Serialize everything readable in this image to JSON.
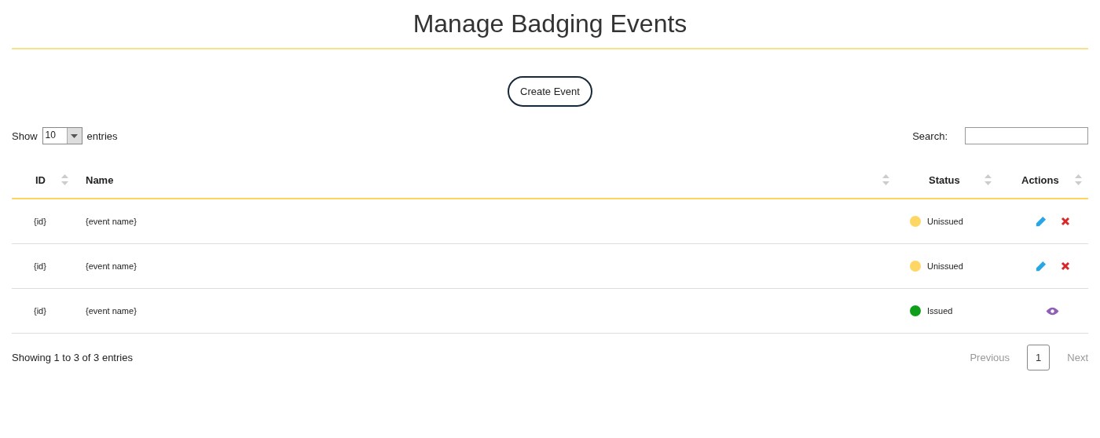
{
  "title": "Manage Badging Events",
  "create_button": "Create Event",
  "length": {
    "before": "Show",
    "value": "10",
    "after": "entries"
  },
  "search": {
    "label": "Search:"
  },
  "columns": [
    {
      "label": "ID"
    },
    {
      "label": "Name"
    },
    {
      "label": "Status"
    },
    {
      "label": "Actions"
    }
  ],
  "rows": [
    {
      "id": "{id}",
      "name": "{event name}",
      "status": "Unissued",
      "color": "#fdd663",
      "actions": [
        {
          "kind": "edit"
        },
        {
          "kind": "delete"
        }
      ]
    },
    {
      "id": "{id}",
      "name": "{event name}",
      "status": "Unissued",
      "color": "#fdd663",
      "actions": [
        {
          "kind": "edit"
        },
        {
          "kind": "delete"
        }
      ]
    },
    {
      "id": "{id}",
      "name": "{event name}",
      "status": "Issued",
      "color": "#0e9e1a",
      "actions": [
        {
          "kind": "view"
        }
      ]
    }
  ],
  "info": "Showing 1 to 3 of 3 entries",
  "pagination": {
    "previous": {
      "label": "Previous",
      "disabled": true
    },
    "pages": [
      {
        "label": "1",
        "selected": true
      }
    ],
    "next": {
      "label": "Next",
      "disabled": true
    }
  }
}
